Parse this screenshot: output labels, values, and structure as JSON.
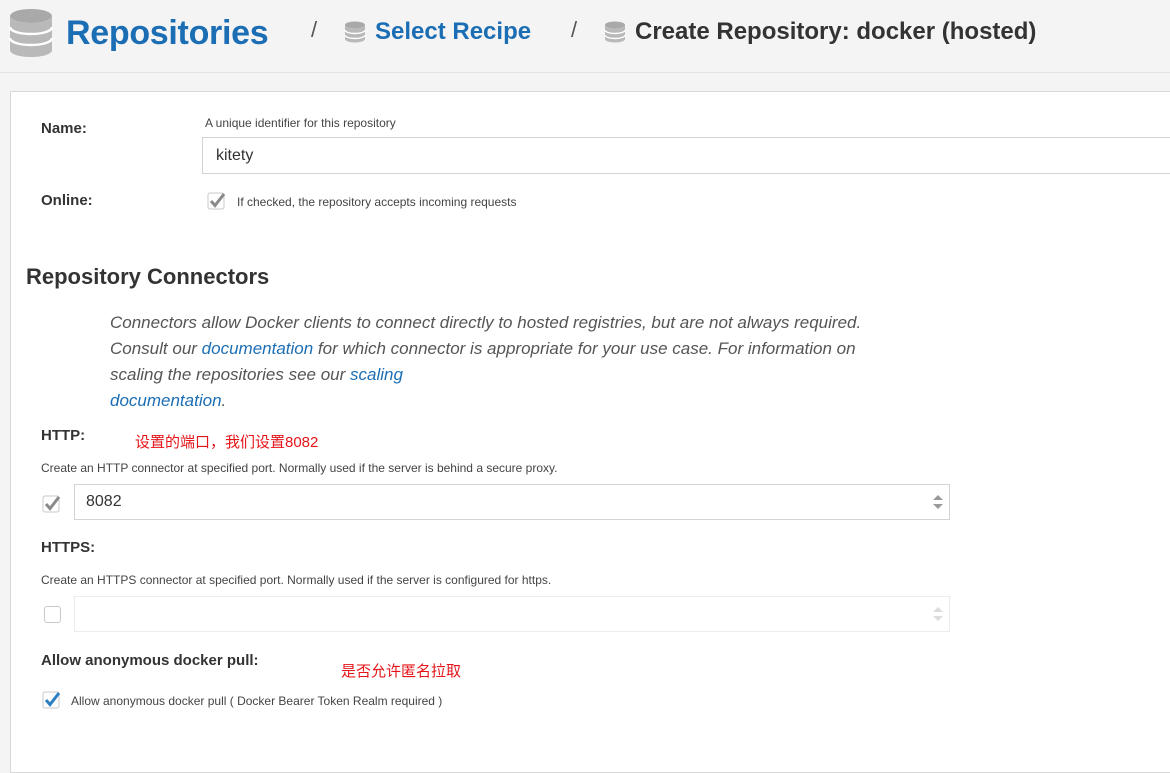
{
  "breadcrumb": {
    "repositories": "Repositories",
    "separator": "/",
    "select_recipe": "Select Recipe",
    "create_repository": "Create Repository: docker (hosted)"
  },
  "form": {
    "name": {
      "label": "Name:",
      "hint": "A unique identifier for this repository",
      "value": "kitety"
    },
    "online": {
      "label": "Online:",
      "checked": true,
      "text": "If checked, the repository accepts incoming requests"
    }
  },
  "connectors": {
    "title": "Repository Connectors",
    "description": {
      "part1": "Connectors allow Docker clients to connect directly to hosted registries, but are not always required. Consult our ",
      "link1": "documentation",
      "part2": " for which connector is appropriate for your use case. For information on scaling the repositories see our ",
      "link2_a": "scaling",
      "link2_b": "documentation",
      "part3": "."
    },
    "http": {
      "label": "HTTP:",
      "annotation": "设置的端口，我们设置8082",
      "hint": "Create an HTTP connector at specified port. Normally used if the server is behind a secure proxy.",
      "checked": true,
      "value": "8082"
    },
    "https": {
      "label": "HTTPS:",
      "hint": "Create an HTTPS connector at specified port. Normally used if the server is configured for https.",
      "checked": false,
      "value": ""
    },
    "anonymous": {
      "label": "Allow anonymous docker pull:",
      "annotation": "是否允许匿名拉取",
      "checked": true,
      "text": "Allow anonymous docker pull ( Docker Bearer Token Realm required )"
    }
  },
  "colors": {
    "link_blue": "#1c6eb4",
    "checkbox_blue": "#2c7fc3",
    "annotation_red": "#e5151a"
  }
}
